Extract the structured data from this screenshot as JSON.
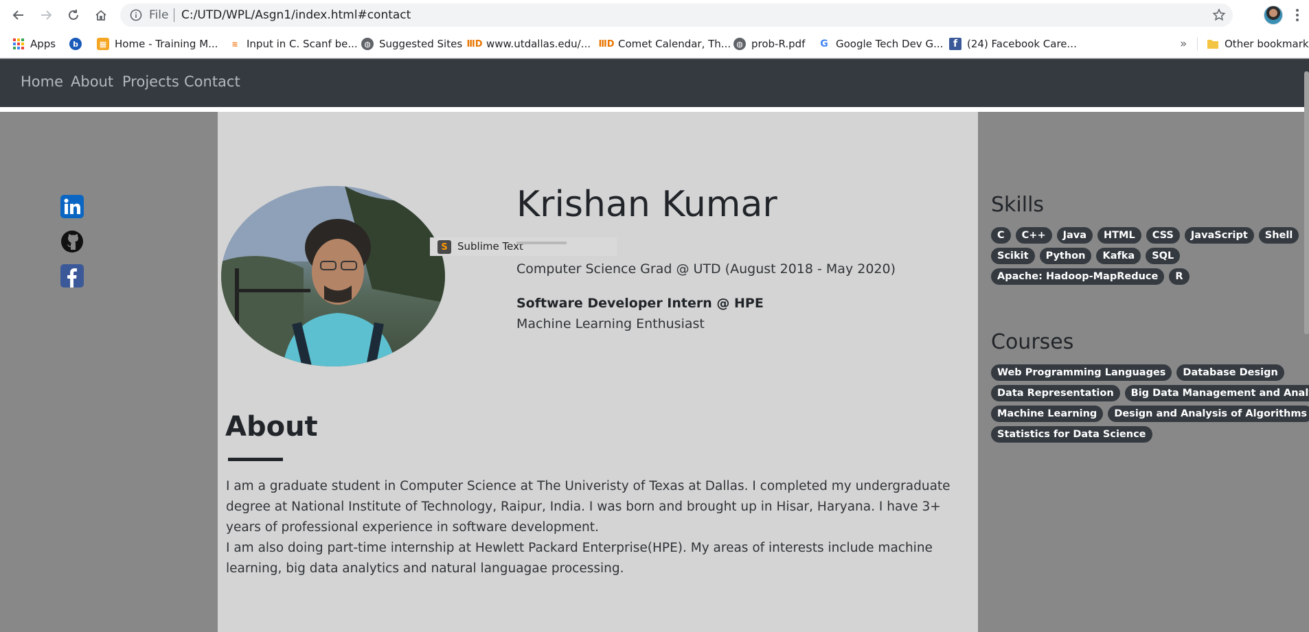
{
  "browser": {
    "omnibox": {
      "scheme": "File",
      "url": "C:/UTD/WPL/Asgn1/index.html#contact"
    },
    "bookmarks": [
      {
        "label": "Apps",
        "icon": "apps-grid-icon"
      },
      {
        "label": "",
        "icon": "bing-icon"
      },
      {
        "label": "Home - Training M...",
        "icon": "training-icon"
      },
      {
        "label": "Input in C. Scanf be...",
        "icon": "stackoverflow-icon"
      },
      {
        "label": "Suggested Sites",
        "icon": "globe-icon"
      },
      {
        "label": "www.utdallas.edu/...",
        "icon": "utd-icon"
      },
      {
        "label": "Comet Calendar, Th...",
        "icon": "utd-icon"
      },
      {
        "label": "prob-R.pdf",
        "icon": "globe-icon"
      },
      {
        "label": "Google Tech Dev G...",
        "icon": "google-icon"
      },
      {
        "label": "(24) Facebook Care...",
        "icon": "facebook-icon"
      }
    ],
    "overflow_label": "»",
    "other_bookmarks": "Other bookmarks"
  },
  "site_nav": [
    "Home",
    "About",
    "Projects",
    "Contact"
  ],
  "social_links": [
    "linkedin-icon",
    "github-icon",
    "facebook-icon"
  ],
  "hero": {
    "name": "Krishan Kumar",
    "education": "Computer Science Grad @ UTD (August 2018 - May 2020)",
    "role": "Software Developer Intern @ HPE",
    "interest": "Machine Learning Enthusiast"
  },
  "tooltip": {
    "label": "Sublime Text"
  },
  "about": {
    "title": "About",
    "paragraph1": "I am a graduate student in Computer Science at The Univeristy of Texas at Dallas. I completed my undergraduate degree at National Institute of Technology, Raipur, India. I was born and brought up in Hisar, Haryana. I have 3+ years of professional experience in software development.",
    "paragraph2": "I am also doing part-time internship at Hewlett Packard Enterprise(HPE). My areas of interests include machine learning, big data analytics and natural languagae processing."
  },
  "skills": {
    "title": "Skills",
    "rows": [
      [
        "C",
        "C++",
        "Java",
        "HTML",
        "CSS",
        "JavaScript",
        "Shell"
      ],
      [
        "Scikit",
        "Python",
        "Kafka",
        "SQL"
      ],
      [
        "Apache: Hadoop-MapReduce",
        "R"
      ]
    ]
  },
  "courses": {
    "title": "Courses",
    "rows": [
      [
        "Web Programming Languages",
        "Database Design"
      ],
      [
        "Data Representation",
        "Big Data Management and Analytics"
      ],
      [
        "Machine Learning",
        "Design and Analysis of Algorithms"
      ],
      [
        "Statistics for Data Science"
      ]
    ]
  },
  "colors": {
    "nav_bg": "#343a40",
    "content_bg": "#d4d4d4",
    "side_bg": "#888888",
    "badge_bg": "#343a40"
  }
}
